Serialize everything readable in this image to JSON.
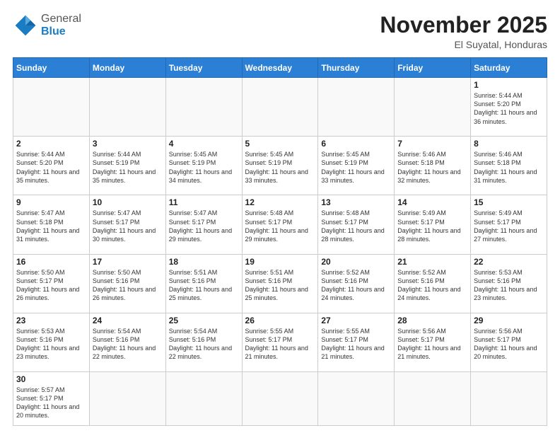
{
  "header": {
    "logo_general": "General",
    "logo_blue": "Blue",
    "month": "November 2025",
    "location": "El Suyatal, Honduras"
  },
  "weekdays": [
    "Sunday",
    "Monday",
    "Tuesday",
    "Wednesday",
    "Thursday",
    "Friday",
    "Saturday"
  ],
  "weeks": [
    [
      {
        "day": "",
        "info": ""
      },
      {
        "day": "",
        "info": ""
      },
      {
        "day": "",
        "info": ""
      },
      {
        "day": "",
        "info": ""
      },
      {
        "day": "",
        "info": ""
      },
      {
        "day": "",
        "info": ""
      },
      {
        "day": "1",
        "info": "Sunrise: 5:44 AM\nSunset: 5:20 PM\nDaylight: 11 hours and 36 minutes."
      }
    ],
    [
      {
        "day": "2",
        "info": "Sunrise: 5:44 AM\nSunset: 5:20 PM\nDaylight: 11 hours and 35 minutes."
      },
      {
        "day": "3",
        "info": "Sunrise: 5:44 AM\nSunset: 5:19 PM\nDaylight: 11 hours and 35 minutes."
      },
      {
        "day": "4",
        "info": "Sunrise: 5:45 AM\nSunset: 5:19 PM\nDaylight: 11 hours and 34 minutes."
      },
      {
        "day": "5",
        "info": "Sunrise: 5:45 AM\nSunset: 5:19 PM\nDaylight: 11 hours and 33 minutes."
      },
      {
        "day": "6",
        "info": "Sunrise: 5:45 AM\nSunset: 5:19 PM\nDaylight: 11 hours and 33 minutes."
      },
      {
        "day": "7",
        "info": "Sunrise: 5:46 AM\nSunset: 5:18 PM\nDaylight: 11 hours and 32 minutes."
      },
      {
        "day": "8",
        "info": "Sunrise: 5:46 AM\nSunset: 5:18 PM\nDaylight: 11 hours and 31 minutes."
      }
    ],
    [
      {
        "day": "9",
        "info": "Sunrise: 5:47 AM\nSunset: 5:18 PM\nDaylight: 11 hours and 31 minutes."
      },
      {
        "day": "10",
        "info": "Sunrise: 5:47 AM\nSunset: 5:17 PM\nDaylight: 11 hours and 30 minutes."
      },
      {
        "day": "11",
        "info": "Sunrise: 5:47 AM\nSunset: 5:17 PM\nDaylight: 11 hours and 29 minutes."
      },
      {
        "day": "12",
        "info": "Sunrise: 5:48 AM\nSunset: 5:17 PM\nDaylight: 11 hours and 29 minutes."
      },
      {
        "day": "13",
        "info": "Sunrise: 5:48 AM\nSunset: 5:17 PM\nDaylight: 11 hours and 28 minutes."
      },
      {
        "day": "14",
        "info": "Sunrise: 5:49 AM\nSunset: 5:17 PM\nDaylight: 11 hours and 28 minutes."
      },
      {
        "day": "15",
        "info": "Sunrise: 5:49 AM\nSunset: 5:17 PM\nDaylight: 11 hours and 27 minutes."
      }
    ],
    [
      {
        "day": "16",
        "info": "Sunrise: 5:50 AM\nSunset: 5:17 PM\nDaylight: 11 hours and 26 minutes."
      },
      {
        "day": "17",
        "info": "Sunrise: 5:50 AM\nSunset: 5:16 PM\nDaylight: 11 hours and 26 minutes."
      },
      {
        "day": "18",
        "info": "Sunrise: 5:51 AM\nSunset: 5:16 PM\nDaylight: 11 hours and 25 minutes."
      },
      {
        "day": "19",
        "info": "Sunrise: 5:51 AM\nSunset: 5:16 PM\nDaylight: 11 hours and 25 minutes."
      },
      {
        "day": "20",
        "info": "Sunrise: 5:52 AM\nSunset: 5:16 PM\nDaylight: 11 hours and 24 minutes."
      },
      {
        "day": "21",
        "info": "Sunrise: 5:52 AM\nSunset: 5:16 PM\nDaylight: 11 hours and 24 minutes."
      },
      {
        "day": "22",
        "info": "Sunrise: 5:53 AM\nSunset: 5:16 PM\nDaylight: 11 hours and 23 minutes."
      }
    ],
    [
      {
        "day": "23",
        "info": "Sunrise: 5:53 AM\nSunset: 5:16 PM\nDaylight: 11 hours and 23 minutes."
      },
      {
        "day": "24",
        "info": "Sunrise: 5:54 AM\nSunset: 5:16 PM\nDaylight: 11 hours and 22 minutes."
      },
      {
        "day": "25",
        "info": "Sunrise: 5:54 AM\nSunset: 5:16 PM\nDaylight: 11 hours and 22 minutes."
      },
      {
        "day": "26",
        "info": "Sunrise: 5:55 AM\nSunset: 5:17 PM\nDaylight: 11 hours and 21 minutes."
      },
      {
        "day": "27",
        "info": "Sunrise: 5:55 AM\nSunset: 5:17 PM\nDaylight: 11 hours and 21 minutes."
      },
      {
        "day": "28",
        "info": "Sunrise: 5:56 AM\nSunset: 5:17 PM\nDaylight: 11 hours and 21 minutes."
      },
      {
        "day": "29",
        "info": "Sunrise: 5:56 AM\nSunset: 5:17 PM\nDaylight: 11 hours and 20 minutes."
      }
    ],
    [
      {
        "day": "30",
        "info": "Sunrise: 5:57 AM\nSunset: 5:17 PM\nDaylight: 11 hours and 20 minutes."
      },
      {
        "day": "",
        "info": ""
      },
      {
        "day": "",
        "info": ""
      },
      {
        "day": "",
        "info": ""
      },
      {
        "day": "",
        "info": ""
      },
      {
        "day": "",
        "info": ""
      },
      {
        "day": "",
        "info": ""
      }
    ]
  ]
}
